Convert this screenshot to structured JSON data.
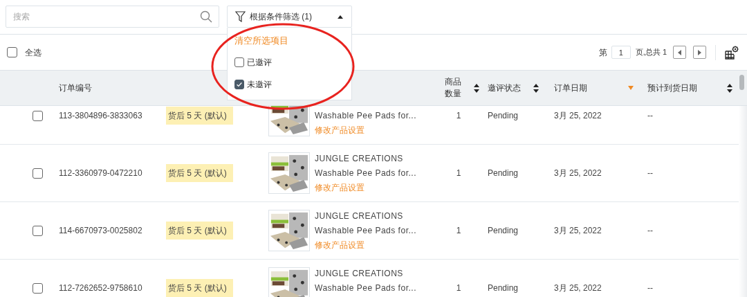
{
  "search": {
    "placeholder": "搜索"
  },
  "filter": {
    "label": "根据条件筛选 (1)",
    "expanded": true,
    "clear_label": "清空所选项目",
    "options": [
      {
        "label": "已邀评",
        "checked": false
      },
      {
        "label": "未邀评",
        "checked": true
      }
    ]
  },
  "select_all": {
    "label": "全选",
    "checked": false
  },
  "pagination": {
    "prefix": "第",
    "page": "1",
    "suffix": "页,总共 1"
  },
  "table": {
    "columns": [
      {
        "label": "订单编号",
        "sortable": false
      },
      {
        "label": "商品数量",
        "sortable": true,
        "sorted_descending": false
      },
      {
        "label": "邀评状态",
        "sortable": true,
        "sorted_descending": false
      },
      {
        "label": "订单日期",
        "sortable": true,
        "sorted_descending": true
      },
      {
        "label": "预计到货日期",
        "sortable": true,
        "sorted_descending": false
      }
    ],
    "rows": [
      {
        "checked": false,
        "order_number": "113-3804896-3833063",
        "delivery_note": "货后 5 天 (默认)",
        "product": "Washable Pee Pads for...",
        "link": "修改产品设置",
        "quantity": "1",
        "status": "Pending",
        "order_date": "3月 25, 2022",
        "expected": "--"
      },
      {
        "checked": false,
        "order_number": "112-3360979-0472210",
        "delivery_note": "货后 5 天 (默认)",
        "brand": "JUNGLE CREATIONS",
        "product": "Washable Pee Pads for...",
        "link": "修改产品设置",
        "quantity": "1",
        "status": "Pending",
        "order_date": "3月 25, 2022",
        "expected": "--"
      },
      {
        "checked": false,
        "order_number": "114-6670973-0025802",
        "delivery_note": "货后 5 天 (默认)",
        "brand": "JUNGLE CREATIONS",
        "product": "Washable Pee Pads for...",
        "link": "修改产品设置",
        "quantity": "1",
        "status": "Pending",
        "order_date": "3月 25, 2022",
        "expected": "--"
      },
      {
        "checked": false,
        "order_number": "112-7262652-9758610",
        "delivery_note": "货后 5 天 (默认)",
        "brand": "JUNGLE CREATIONS",
        "product": "Washable Pee Pads for...",
        "quantity": "1",
        "status": "Pending",
        "order_date": "3月 25, 2022",
        "expected": "--"
      }
    ]
  },
  "annotation": {
    "kind": "ellipse",
    "color": "#e8231f"
  }
}
